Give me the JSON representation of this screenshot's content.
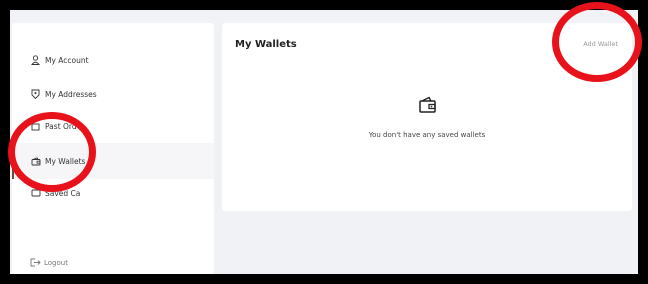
{
  "sidebar": {
    "items": [
      {
        "label": "My Account",
        "icon": "user-icon"
      },
      {
        "label": "My Addresses",
        "icon": "location-pin-icon"
      },
      {
        "label": "Past Ord",
        "icon": "box-icon"
      },
      {
        "label": "My Wallets",
        "icon": "wallet-icon",
        "active": true
      },
      {
        "label": "Saved Ca",
        "icon": "card-icon"
      }
    ],
    "logout_label": "Logout"
  },
  "main": {
    "title": "My Wallets",
    "add_wallet_label": "Add Wallet",
    "empty_icon": "wallet-icon",
    "empty_message": "You don't have any saved wallets"
  },
  "colors": {
    "annotation_ring": "#e8121a",
    "active_marker": "#6b4a3a",
    "background": "#f1f2f5"
  }
}
